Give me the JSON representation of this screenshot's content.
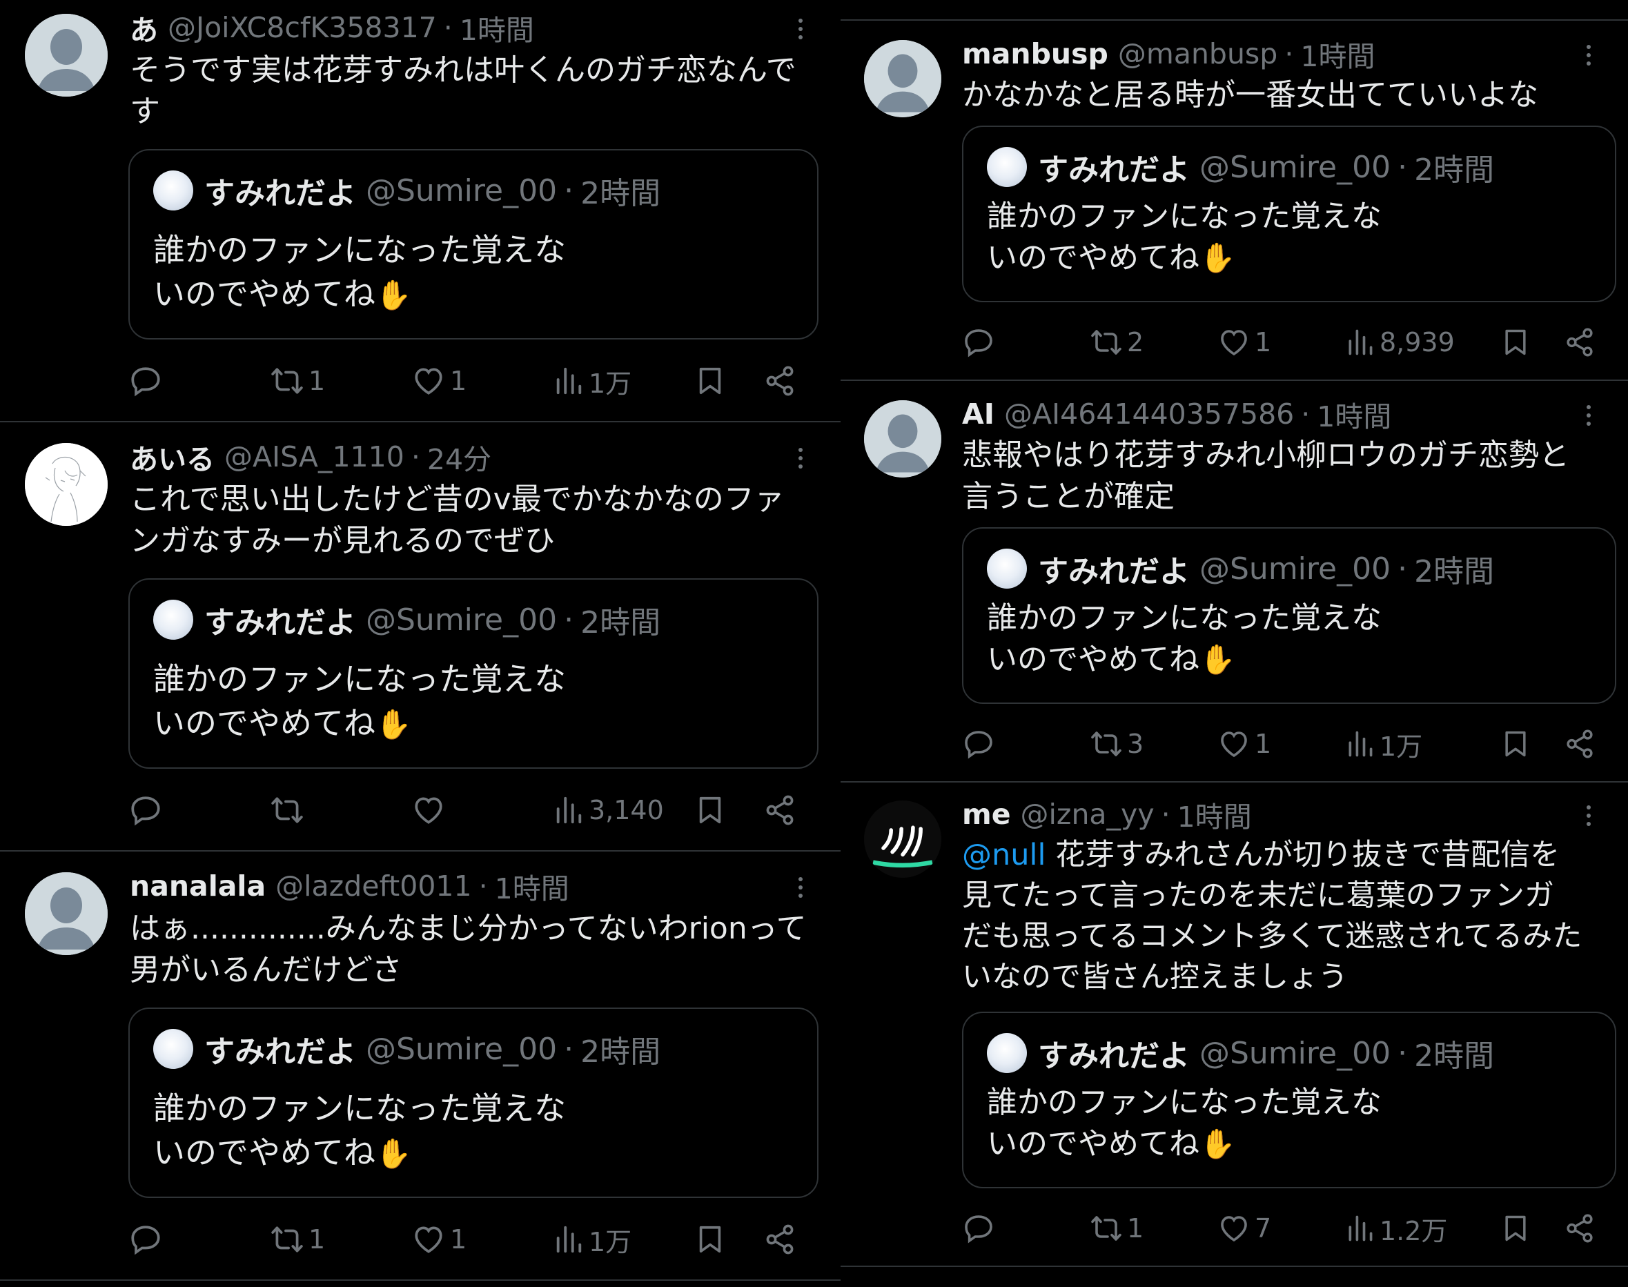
{
  "quoted_tweet": {
    "name": "すみれだよ",
    "handle": "@Sumire_00",
    "separator": "·",
    "time": "2時間",
    "text": "誰かのファンになった覚えないのでやめてね",
    "emoji": "✋"
  },
  "icons": {
    "reply": "reply-icon",
    "retweet": "retweet-icon",
    "like": "heart-icon",
    "views": "views-icon",
    "bookmark": "bookmark-icon",
    "share": "share-icon",
    "more": "more-icon"
  },
  "colors": {
    "background": "#000000",
    "text": "#e7e9ea",
    "muted": "#71767b",
    "border": "#2f3336",
    "link": "#1d9bf0"
  },
  "left_column": [
    {
      "name": "あ",
      "handle": "@JoiXC8cfK358317",
      "separator": "·",
      "time": "1時間",
      "text": "そうです実は花芽すみれは叶くんのガチ恋なんです",
      "replies": "",
      "retweets": "1",
      "likes": "1",
      "views": "1万"
    },
    {
      "name": "あいる",
      "handle": "@AISA_1110",
      "separator": "·",
      "time": "24分",
      "text": "これで思い出したけど昔のv最でかなかなのファンガなすみーが見れるのでぜひ",
      "replies": "",
      "retweets": "",
      "likes": "",
      "views": "3,140"
    },
    {
      "name": "nanalala",
      "handle": "@lazdeft0011",
      "separator": "·",
      "time": "1時間",
      "text": "はぁ..............みんなまじ分かってないわrionって男がいるんだけどさ",
      "replies": "",
      "retweets": "1",
      "likes": "1",
      "views": "1万"
    }
  ],
  "right_column": [
    {
      "name": "manbusp",
      "handle": "@manbusp",
      "separator": "·",
      "time": "1時間",
      "text": "かなかなと居る時が一番女出てていいよな",
      "replies": "",
      "retweets": "2",
      "likes": "1",
      "views": "8,939"
    },
    {
      "name": "AI",
      "handle": "@AI4641440357586",
      "separator": "·",
      "time": "1時間",
      "text": "悲報やはり花芽すみれ小柳ロウのガチ恋勢と言うことが確定",
      "replies": "",
      "retweets": "3",
      "likes": "1",
      "views": "1万"
    },
    {
      "name": "me",
      "handle": "@izna_yy",
      "separator": "·",
      "time": "1時間",
      "mention": "@null",
      "text": " 花芽すみれさんが切り抜きで昔配信を見てたって言ったのを未だに葛葉のファンガだも思ってるコメント多くて迷惑されてるみたいなので皆さん控えましょう",
      "replies": "",
      "retweets": "1",
      "likes": "7",
      "views": "1.2万"
    }
  ]
}
